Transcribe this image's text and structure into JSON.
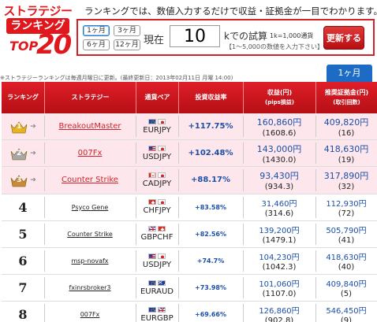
{
  "logo": {
    "line1": "ストラテジー",
    "line2": "ランキング",
    "top_word": "TOP",
    "number": "20"
  },
  "panel": {
    "note": "ランキングでは、数値入力するだけで収益・証拠金が一目でわかります。",
    "period_buttons": [
      "1ヶ月",
      "3ヶ月",
      "6ヶ月",
      "12ヶ月"
    ],
    "active_period": "1ヶ月",
    "current_label": "現在",
    "amount_value": "10",
    "unit_label": "kでの試算",
    "unit_note": "1k=1,000通貨",
    "unit_range": "【1〜5,000の数値を入力下さい】",
    "update_label": "更新する"
  },
  "info_text": "※ストラテジーランキングは毎週月曜日に更新。(最終更新日：2013年02月11日 月曜 14:00)",
  "period_tab": "1ヶ月",
  "table": {
    "headers": {
      "rank": "ランキング",
      "strategy": "ストラテジー",
      "pair": "通貨ペア",
      "rate": "投資収益率",
      "profit": "収益(円)",
      "profit_sub": "(pips損益)",
      "margin": "推奨証拠金(円)",
      "margin_sub": "(取引回数)"
    },
    "rows": [
      {
        "rank": "1",
        "strategy": "BreakoutMaster",
        "pair": "EURJPY",
        "rate": "+117.75%",
        "profit": "160,860円",
        "pips": "(1608.6)",
        "margin": "409,820円",
        "trades": "(16)"
      },
      {
        "rank": "2",
        "strategy": "007Fx",
        "pair": "USDJPY",
        "rate": "+102.48%",
        "profit": "143,000円",
        "pips": "(1430.0)",
        "margin": "418,630円",
        "trades": "(19)"
      },
      {
        "rank": "3",
        "strategy": "Counter Strike",
        "pair": "CADJPY",
        "rate": "+88.17%",
        "profit": "93,430円",
        "pips": "(934.3)",
        "margin": "317,890円",
        "trades": "(32)"
      },
      {
        "rank": "4",
        "strategy": "Psyco Gene",
        "pair": "CHFJPY",
        "rate": "+83.58%",
        "profit": "31,460円",
        "pips": "(314.6)",
        "margin": "112,930円",
        "trades": "(72)"
      },
      {
        "rank": "5",
        "strategy": "Counter Strike",
        "pair": "GBPCHF",
        "rate": "+82.56%",
        "profit": "139,200円",
        "pips": "(1479.1)",
        "margin": "505,790円",
        "trades": "(41)"
      },
      {
        "rank": "6",
        "strategy": "msp-novafx",
        "pair": "USDJPY",
        "rate": "+74.7%",
        "profit": "104,230円",
        "pips": "(1042.3)",
        "margin": "418,630円",
        "trades": "(40)"
      },
      {
        "rank": "7",
        "strategy": "fxinrsbroker3",
        "pair": "EURAUD",
        "rate": "+73.98%",
        "profit": "101,060円",
        "pips": "(1107.0)",
        "margin": "409,840円",
        "trades": "(5)"
      },
      {
        "rank": "8",
        "strategy": "007Fx",
        "pair": "EURGBP",
        "rate": "+69.66%",
        "profit": "126,860円",
        "pips": "(902.8)",
        "margin": "546,450円",
        "trades": "(9)"
      }
    ]
  },
  "crown_colors": {
    "gold": "#e8b321",
    "silver": "#a8a8a8",
    "bronze": "#c98a3a"
  },
  "accent_red": "#d2232a",
  "accent_blue": "#1c4fa8"
}
